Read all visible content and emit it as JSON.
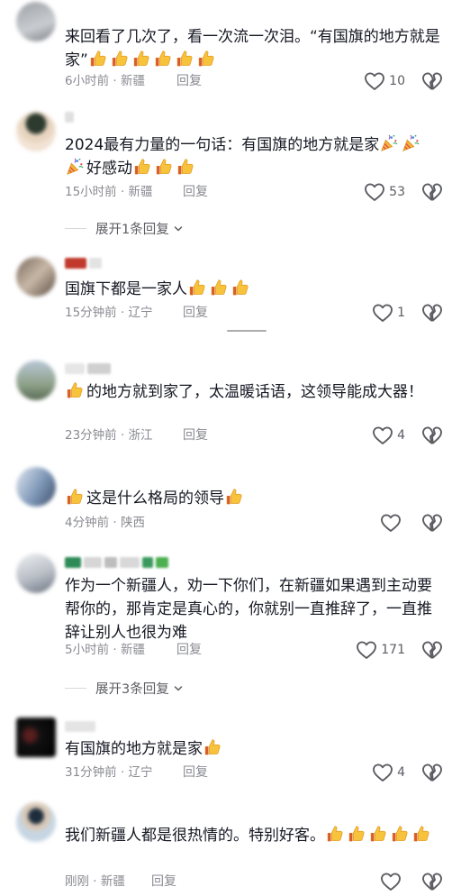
{
  "comments": [
    {
      "text": "来回看了几次了，看一次流一次泪。“有国旗的地方就是家”",
      "emoji": [
        "thumbs-up-icon",
        "thumbs-up-icon",
        "thumbs-up-icon",
        "thumbs-up-icon",
        "thumbs-up-icon",
        "thumbs-up-icon"
      ],
      "time": "6小时前 · 新疆",
      "reply": "回复",
      "likes": "10"
    },
    {
      "text": "2024最有力量的一句话：有国旗的地方就是家",
      "text2": "好感动",
      "emoji_mid": [
        "party-popper-icon",
        "party-popper-icon",
        "party-popper-icon"
      ],
      "emoji": [
        "thumbs-up-icon",
        "thumbs-up-icon",
        "thumbs-up-icon"
      ],
      "time": "15小时前 · 新疆",
      "reply": "回复",
      "likes": "53",
      "expand": "展开1条回复"
    },
    {
      "text": "国旗下都是一家人",
      "emoji": [
        "thumbs-up-icon",
        "thumbs-up-icon",
        "thumbs-up-icon"
      ],
      "time": "15分钟前 · 辽宁",
      "reply": "回复",
      "likes": "1"
    },
    {
      "text": "的地方就到家了，太温暖话语，这领导能成大器！",
      "emoji_lead": [
        "thumbs-up-icon"
      ],
      "time": "23分钟前 · 浙江",
      "reply": "回复",
      "likes": "4"
    },
    {
      "text": "这是什么格局的领导",
      "emoji_lead": [
        "thumbs-up-icon"
      ],
      "emoji": [
        "thumbs-up-icon"
      ],
      "time": "4分钟前 · 陕西",
      "reply": "回复",
      "likes": ""
    },
    {
      "text": "作为一个新疆人，劝一下你们，在新疆如果遇到主动要帮你的，那肯定是真心的，你就别一直推辞了，一直推辞让别人也很为难",
      "time": "5小时前 · 新疆",
      "reply": "回复",
      "likes": "171",
      "expand": "展开3条回复"
    },
    {
      "text": "有国旗的地方就是家",
      "emoji": [
        "thumbs-up-icon"
      ],
      "time": "31分钟前 · 辽宁",
      "reply": "回复",
      "likes": "4"
    },
    {
      "text": "我们新疆人都是很热情的。特别好客。",
      "emoji": [
        "thumbs-up-icon",
        "thumbs-up-icon",
        "thumbs-up-icon",
        "thumbs-up-icon",
        "thumbs-up-icon"
      ],
      "time": "刚刚 · 新疆",
      "reply": "回复",
      "likes": ""
    }
  ],
  "colors": {
    "text": "#161823",
    "meta": "#8a8b91",
    "icon": "#5c5d63",
    "thumb": "#f2b53a"
  }
}
